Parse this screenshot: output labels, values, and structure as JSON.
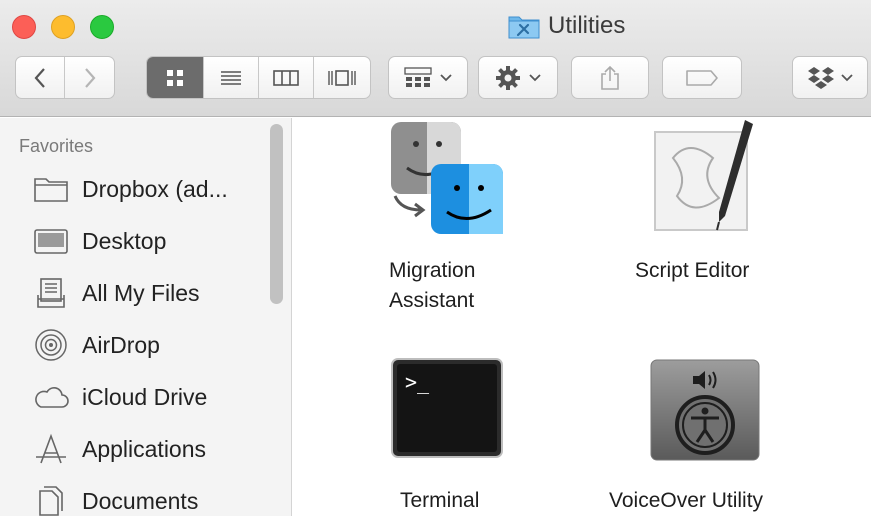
{
  "window": {
    "title": "Utilities"
  },
  "toolbar": {
    "back_icon": "chevron-left-icon",
    "forward_icon": "chevron-right-icon",
    "view_modes": [
      "icon-view",
      "list-view",
      "column-view",
      "cover-flow-view"
    ],
    "active_view": "icon-view",
    "arrange_icon": "arrange-grid-icon",
    "action_icon": "gear-icon",
    "share_icon": "share-icon",
    "tags_icon": "tag-icon",
    "dropbox_icon": "dropbox-icon"
  },
  "sidebar": {
    "heading": "Favorites",
    "items": [
      {
        "label": "Dropbox (ad...",
        "icon": "folder-icon"
      },
      {
        "label": "Desktop",
        "icon": "desktop-icon"
      },
      {
        "label": "All My Files",
        "icon": "all-files-icon"
      },
      {
        "label": "AirDrop",
        "icon": "airdrop-icon"
      },
      {
        "label": "iCloud Drive",
        "icon": "cloud-icon"
      },
      {
        "label": "Applications",
        "icon": "applications-icon"
      },
      {
        "label": "Documents",
        "icon": "documents-icon"
      }
    ]
  },
  "content": {
    "apps": [
      {
        "name_line1": "Migration",
        "name_line2": "Assistant",
        "icon": "migration-assistant-icon"
      },
      {
        "name_line1": "Script Editor",
        "name_line2": "",
        "icon": "script-editor-icon"
      },
      {
        "name_line1": "Terminal",
        "name_line2": "",
        "icon": "terminal-icon"
      },
      {
        "name_line1": "VoiceOver Utility",
        "name_line2": "",
        "icon": "voiceover-utility-icon"
      }
    ],
    "terminal_prompt": ">_"
  },
  "colors": {
    "close": "#fc5f57",
    "minimize": "#fdbc2e",
    "maximize": "#2ac940",
    "active_segment": "#6c6c6c"
  }
}
